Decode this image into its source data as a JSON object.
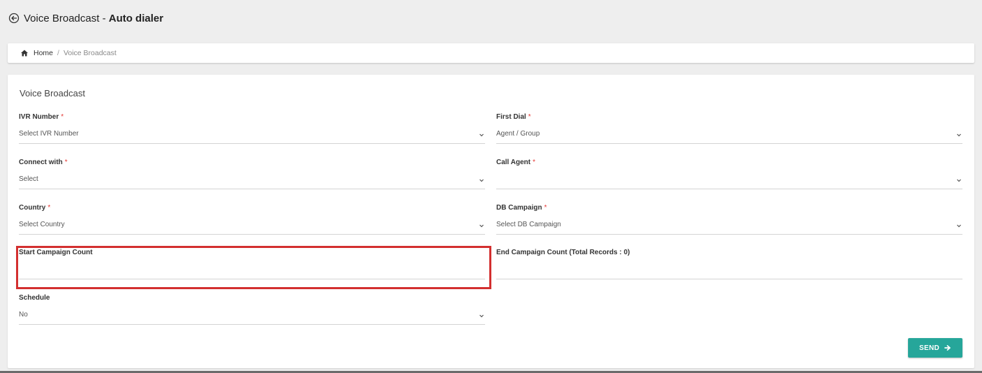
{
  "header": {
    "title_prefix": "Voice Broadcast - ",
    "title_bold": "Auto dialer"
  },
  "breadcrumb": {
    "home": "Home",
    "separator": "/",
    "current": "Voice Broadcast"
  },
  "card": {
    "title": "Voice Broadcast"
  },
  "fields": {
    "ivr_number": {
      "label": "IVR Number",
      "required": "*",
      "value": "Select IVR Number"
    },
    "first_dial": {
      "label": "First Dial",
      "required": "*",
      "value": "Agent / Group"
    },
    "connect_with": {
      "label": "Connect with",
      "required": "*",
      "value": "Select"
    },
    "call_agent": {
      "label": "Call Agent",
      "required": "*",
      "value": ""
    },
    "country": {
      "label": "Country",
      "required": "*",
      "value": "Select Country"
    },
    "db_campaign": {
      "label": "DB Campaign",
      "required": "*",
      "value": "Select DB Campaign"
    },
    "start_campaign_count": {
      "label": "Start Campaign Count",
      "value": ""
    },
    "end_campaign_count": {
      "label": "End Campaign Count (Total Records : 0)",
      "value": ""
    },
    "schedule": {
      "label": "Schedule",
      "value": "No"
    }
  },
  "actions": {
    "send_label": "SEND"
  },
  "colors": {
    "accent": "#26a69a",
    "required": "#e53935",
    "highlight": "#d32f2f"
  },
  "icons": {
    "back": "circle-arrow-left-icon",
    "home": "home-icon",
    "chevron": "chevron-down-icon",
    "send_arrow": "arrow-right-icon"
  }
}
